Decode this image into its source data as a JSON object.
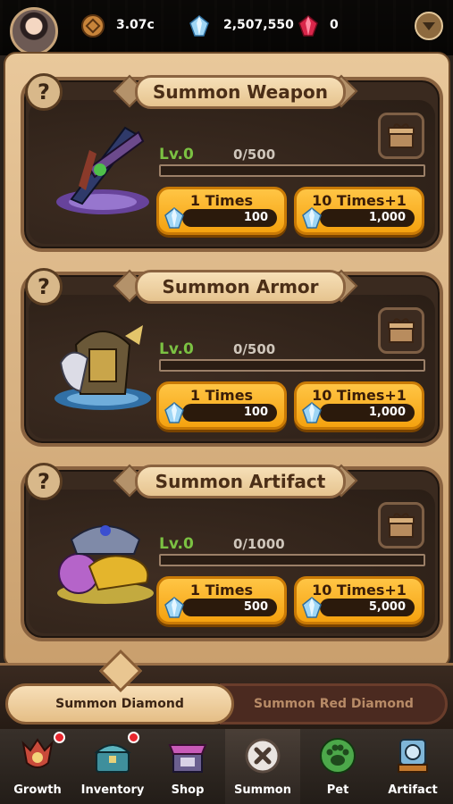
{
  "topbar": {
    "gold": "3.07c",
    "diamonds": "2,507,550",
    "red_diamonds": "0"
  },
  "summons": [
    {
      "title": "Summon Weapon",
      "level": "Lv.0",
      "progress": "0/500",
      "progress_fraction": 0,
      "btn1_label": "1 Times",
      "btn1_cost": "100",
      "btn10_label": "10 Times+1",
      "btn10_cost": "1,000"
    },
    {
      "title": "Summon Armor",
      "level": "Lv.0",
      "progress": "0/500",
      "progress_fraction": 0,
      "btn1_label": "1 Times",
      "btn1_cost": "100",
      "btn10_label": "10 Times+1",
      "btn10_cost": "1,000"
    },
    {
      "title": "Summon Artifact",
      "level": "Lv.0",
      "progress": "0/1000",
      "progress_fraction": 0,
      "btn1_label": "1 Times",
      "btn1_cost": "500",
      "btn10_label": "10 Times+1",
      "btn10_cost": "5,000"
    }
  ],
  "help_glyph": "?",
  "tabs": {
    "active": "Summon Diamond",
    "inactive": "Summon Red Diamond"
  },
  "nav": [
    {
      "label": "Growth",
      "icon": "helmet-icon"
    },
    {
      "label": "Inventory",
      "icon": "chest-icon"
    },
    {
      "label": "Shop",
      "icon": "shop-icon"
    },
    {
      "label": "Summon",
      "icon": "close-icon"
    },
    {
      "label": "Pet",
      "icon": "paw-icon"
    },
    {
      "label": "Artifact",
      "icon": "artifact-icon"
    }
  ],
  "colors": {
    "accent": "#f5a20f",
    "level": "#7bc142",
    "notification": "#e8262e"
  }
}
